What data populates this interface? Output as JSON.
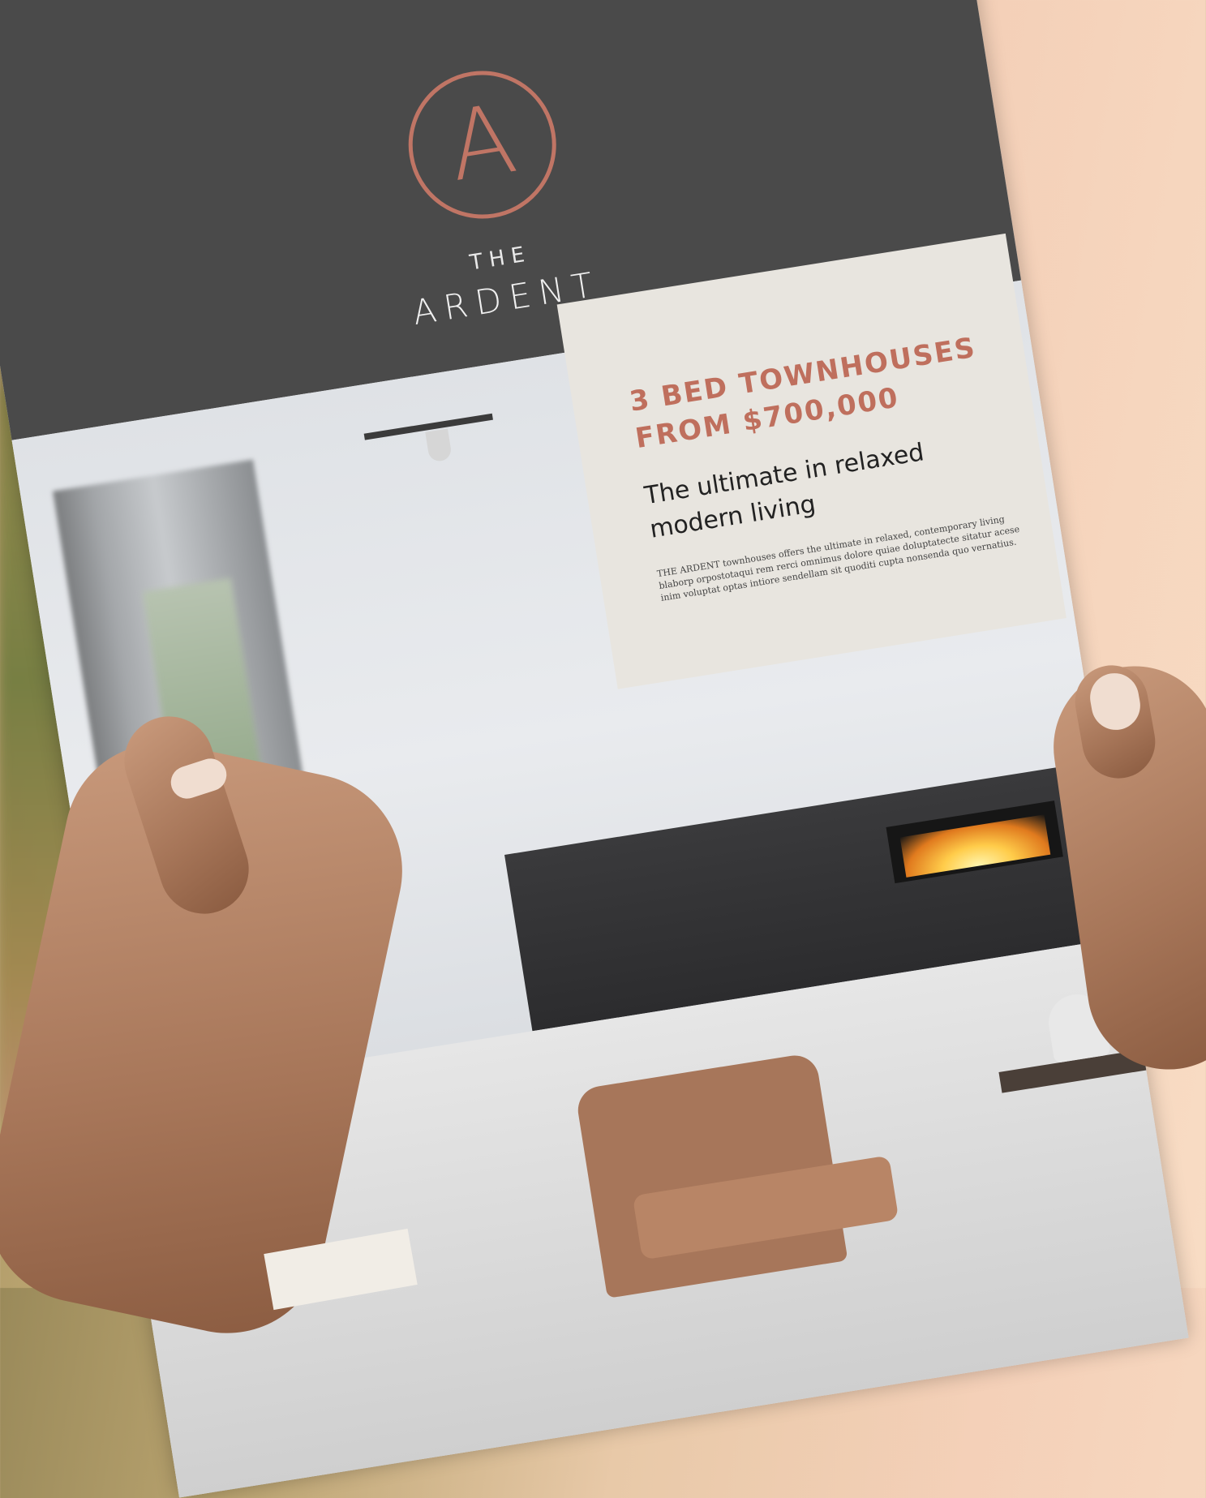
{
  "brand": {
    "the": "THE",
    "name": "ARDENT",
    "logo_letter": "A",
    "accent_color": "#c07565"
  },
  "card": {
    "title_line1": "3 BED TOWNHOUSES",
    "title_line2": "FROM $700,000",
    "subtitle_line1": "The ultimate in relaxed",
    "subtitle_line2": "modern living",
    "body": "THE ARDENT townhouses offers the ultimate in relaxed, contemporary living blaborp orpostotaqui rem rerci omnimus dolore quiae doluptatecte sitatur acese inim voluptat optas intiore sendellam sit quoditi cupta nonsenda quo vernatius."
  },
  "colors": {
    "header_band": "#4a4a4a",
    "title_text": "#bf6f5d",
    "card_background": "#e8e5df"
  }
}
